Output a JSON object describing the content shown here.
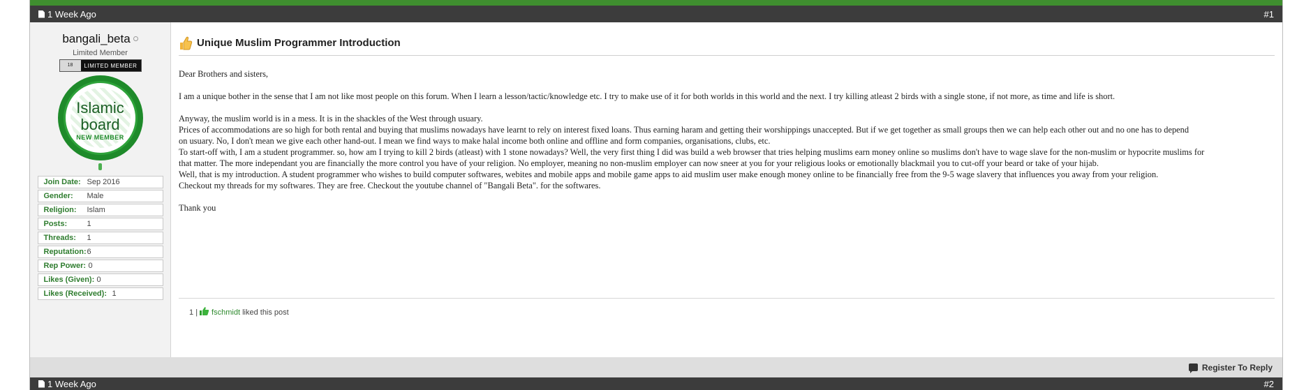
{
  "post1": {
    "timestamp": "1 Week Ago",
    "number": "#1"
  },
  "post2": {
    "timestamp": "1 Week Ago",
    "number": "#2"
  },
  "user": {
    "name": "bangali_beta",
    "title": "Limited Member",
    "rank_left": "18",
    "rank_right": "LIMITED MEMBER",
    "avatar_line1": "Islamic",
    "avatar_line2": "board",
    "avatar_line3": "NEW MEMBER",
    "stats": [
      {
        "label": "Join Date:",
        "value": "Sep 2016"
      },
      {
        "label": "Gender:",
        "value": "Male"
      },
      {
        "label": "Religion:",
        "value": "Islam"
      },
      {
        "label": "Posts:",
        "value": "1"
      },
      {
        "label": "Threads:",
        "value": "1"
      },
      {
        "label": "Reputation:",
        "value": "6"
      },
      {
        "label": "Rep Power:",
        "value": "0"
      },
      {
        "label": "Likes (Given):",
        "value": "0"
      },
      {
        "label": "Likes (Received):",
        "value": "1"
      }
    ]
  },
  "post": {
    "title": "Unique Muslim Programmer Introduction",
    "paragraphs": [
      "Dear Brothers and sisters,",
      "",
      "I am a unique bother in the sense that I am not like most people on this forum. When I learn a lesson/tactic/knowledge etc. I try to make use of it for both worlds in this world and the next. I try killing atleast 2 birds with a single stone, if not more, as time and life is short.",
      "",
      "Anyway, the muslim world is in a mess. It is in the shackles of the West through usuary.",
      "Prices of accommodations are so high for both rental and buying that muslims nowadays have learnt to rely on interest fixed loans. Thus earning haram and getting their worshippings unaccepted. But if we get together as small groups then we can help each other out and no one has to depend",
      "on usuary. No, I don't mean we give each other hand-out. I mean we find ways to make halal income both online and offline and form companies, organisations, clubs, etc.",
      "To start-off with, I am a student programmer. so, how am I trying to kill 2 birds (atleast) with 1 stone nowadays? Well, the very first thing I did was build a web browser that tries helping muslims earn money online so muslims don't have to wage slave for the non-muslim or hypocrite muslims for",
      "that matter. The more independant you are financially the more control you have of your religion. No employer, meaning no non-muslim employer can now sneer at you for your religious looks or emotionally blackmail you to cut-off your beard or take of your hijab.",
      "Well, that is my introduction. A student programmer who wishes to build computer softwares, webites and mobile apps and mobile game apps to aid muslim user make enough money online to be financially free from the 9-5 wage slavery that influences you away from your religion.",
      "Checkout my threads for my softwares. They are free. Checkout the youtube channel of \"Bangali Beta\". for the softwares.",
      "",
      "Thank you"
    ],
    "likes_count": "1",
    "likes_separator": "|",
    "likes_user": "fschmidt",
    "likes_text": "liked this post"
  },
  "footer": {
    "register_to_reply": "Register To Reply"
  },
  "colors": {
    "accent_green": "#3f8f2f",
    "header_dark": "#3c3c3c"
  }
}
